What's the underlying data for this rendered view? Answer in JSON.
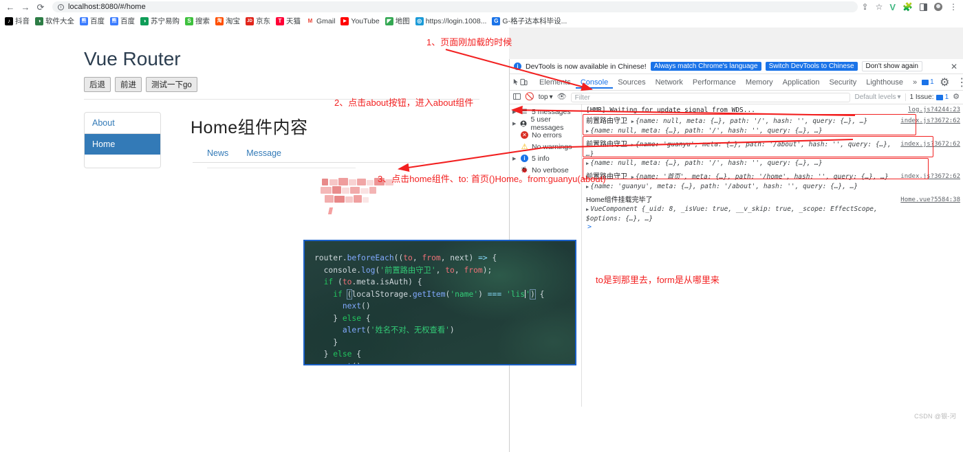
{
  "browser": {
    "url": "localhost:8080/#/home",
    "nav": {
      "back": "←",
      "forward": "→",
      "reload": "⟳"
    },
    "toolbar_icons": [
      "share-icon",
      "star-icon",
      "vue-devtools-icon",
      "extensions-icon",
      "side-panel-icon",
      "profile-avatar",
      "chrome-menu-icon"
    ],
    "bookmarks": [
      {
        "label": "抖音",
        "color": "#000000",
        "glyph": "♪"
      },
      {
        "label": "软件大全",
        "color": "#2d7d46",
        "glyph": "◑"
      },
      {
        "label": "百度",
        "color": "#3b7cff",
        "glyph": "熊"
      },
      {
        "label": "百度",
        "color": "#3b7cff",
        "glyph": "熊"
      },
      {
        "label": "苏宁易购",
        "color": "#0f9d58",
        "glyph": "◑"
      },
      {
        "label": "搜索",
        "color": "#3ec13e",
        "glyph": "S"
      },
      {
        "label": "淘宝",
        "color": "#ff5000",
        "glyph": "淘"
      },
      {
        "label": "京东",
        "color": "#e1251b",
        "glyph": "JD"
      },
      {
        "label": "天猫",
        "color": "#ff0036",
        "glyph": "T"
      },
      {
        "label": "Gmail",
        "color": "#ffffff",
        "glyph": "M"
      },
      {
        "label": "YouTube",
        "color": "#ff0000",
        "glyph": "▶"
      },
      {
        "label": "地图",
        "color": "#34a853",
        "glyph": "◤"
      },
      {
        "label": "https://login.1008...",
        "color": "#1a9ad7",
        "glyph": "◎"
      },
      {
        "label": "G-格子达本科毕设...",
        "color": "#1a73e8",
        "glyph": "G"
      }
    ]
  },
  "app": {
    "title": "Vue Router",
    "buttons": [
      "后退",
      "前进",
      "测试一下go"
    ],
    "nav_items": [
      {
        "label": "About",
        "active": false
      },
      {
        "label": "Home",
        "active": true
      }
    ],
    "content_title": "Home组件内容",
    "tabs": [
      "News",
      "Message"
    ]
  },
  "annotations": {
    "a1": "1、页面刚加载的时候",
    "a2": "2、点击about按钮，进入about组件",
    "a3": "3、点击home组件、to: 首页()Home。from:guanyu(about)",
    "a4": "to是到那里去，form是从哪里来",
    "color": "#f22020"
  },
  "devtools": {
    "banner": {
      "message": "DevTools is now available in Chinese!",
      "btn_primary": "Always match Chrome's language",
      "btn_secondary": "Switch DevTools to Chinese",
      "btn_ghost": "Don't show again",
      "close": "✕"
    },
    "tabs": [
      "Elements",
      "Console",
      "Sources",
      "Network",
      "Performance",
      "Memory",
      "Application",
      "Security",
      "Lighthouse"
    ],
    "selected_tab": "Console",
    "overflow": "»",
    "issues_count": "1",
    "filterbar": {
      "context": "top",
      "filter_placeholder": "Filter",
      "levels": "Default levels",
      "issues": "1 Issue:",
      "issues_count": "1"
    },
    "sidebar": [
      {
        "label": "5 messages",
        "icon": "list-icon",
        "tri": true
      },
      {
        "label": "5 user messages",
        "icon": "person-icon",
        "tri": true
      },
      {
        "label": "No errors",
        "icon": "error-icon",
        "tri": false
      },
      {
        "label": "No warnings",
        "icon": "warning-icon",
        "tri": false
      },
      {
        "label": "5 info",
        "icon": "info-icon",
        "tri": true
      },
      {
        "label": "No verbose",
        "icon": "bug-icon",
        "tri": false
      }
    ],
    "logs": [
      {
        "main": "[HMR] Waiting for update signal from WDS...",
        "source": "log.js?4244:23",
        "kind": "plain"
      },
      {
        "label": "前置路由守卫",
        "line1": "{name: null, meta: {…}, path: '/', hash: '', query: {…}, …}",
        "line2": "{name: null, meta: {…}, path: '/', hash: '', query: {…}, …}",
        "source": "index.js?3672:62",
        "kind": "guard",
        "highlighted": true
      },
      {
        "label": "前置路由守卫",
        "line1": "{name: 'guanyu', meta: {…}, path: '/about', hash: '', query: {…}, …}",
        "line2": "{name: null, meta: {…}, path: '/', hash: '', query: {…}, …}",
        "source": "index.js?3672:62",
        "kind": "guard",
        "highlighted": true
      },
      {
        "label": "前置路由守卫",
        "line1": "{name: '首页', meta: {…}, path: '/home', hash: '', query: {…}, …}",
        "line2": "{name: 'guanyu', meta: {…}, path: '/about', hash: '', query: {…}, …}",
        "source": "index.js?3672:62",
        "kind": "guard",
        "highlighted": true
      },
      {
        "label": "Home组件挂载完毕了",
        "line1": "VueComponent {_uid: 8, _isVue: true, __v_skip: true, _scope: EffectScope, $options: {…}, …}",
        "source": "Home.vue?5584:38",
        "kind": "mounted"
      }
    ],
    "prompt": ">"
  },
  "code_snippet": {
    "lines": [
      "router.beforeEach((to, from, next) => {",
      "  console.log('前置路由守卫', to, from);",
      "  if (to.meta.isAuth) {",
      "    if (localStorage.getItem('name') === 'lis') {",
      "      next()",
      "    } else {",
      "      alert('姓名不对、无权查看')",
      "    }",
      "  } else {",
      "    next()"
    ]
  },
  "watermark": "CSDN @银-河"
}
